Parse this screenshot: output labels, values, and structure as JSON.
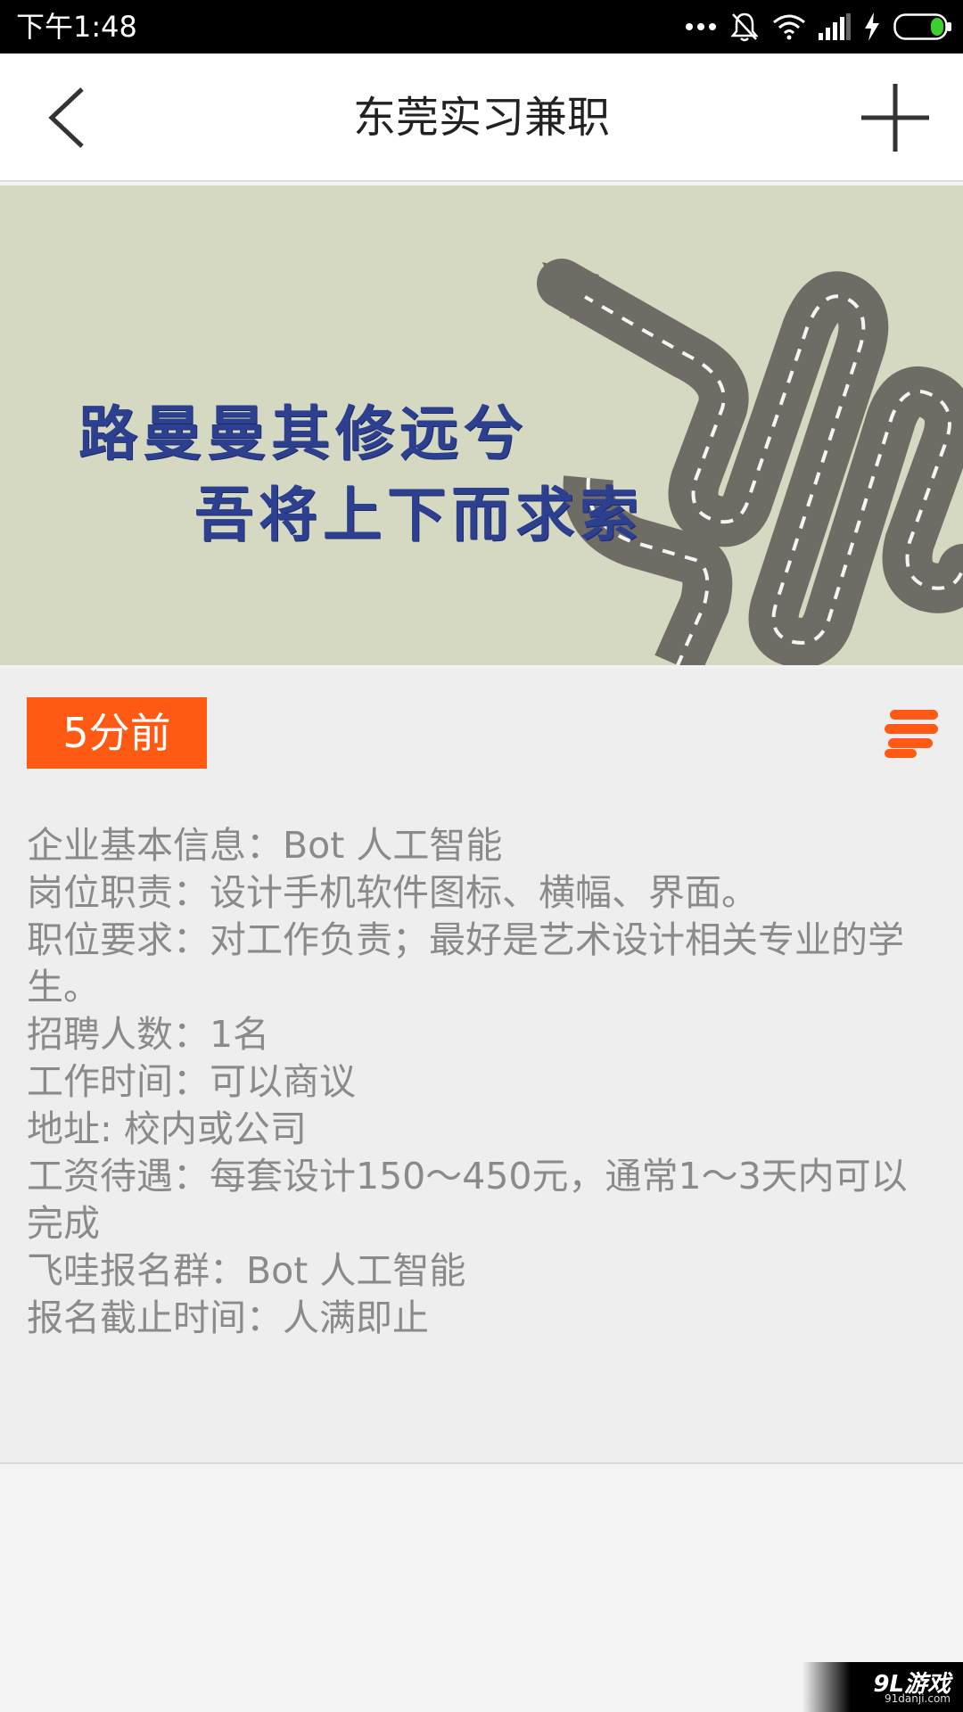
{
  "status_bar": {
    "time": "下午1:48",
    "icons": [
      "more-dots-icon",
      "bell-off-icon",
      "wifi-icon",
      "signal-icon",
      "charging-icon",
      "battery-icon"
    ],
    "battery_color": "#3ccf2e"
  },
  "header": {
    "title": "东莞实习兼职",
    "back_icon": "chevron-left-icon",
    "add_icon": "plus-icon"
  },
  "banner": {
    "line1": "路曼曼其修远兮",
    "line2": "吾将上下而求索",
    "image": "winding-road-arrow"
  },
  "post": {
    "time_badge": "5分前",
    "accent_color": "#ff5a14",
    "menu_icon": "menu-lines-icon",
    "lines": [
      "企业基本信息：Bot 人工智能",
      "岗位职责：设计手机软件图标、横幅、界面。",
      "职位要求：对工作负责；最好是艺术设计相关专业的学生。",
      "招聘人数：1名",
      "工作时间：可以商议",
      "地址: 校内或公司",
      "工资待遇：每套设计150～450元，通常1～3天内可以完成",
      "飞哇报名群：Bot 人工智能",
      "报名截止时间：人满即止"
    ]
  },
  "watermark": {
    "main": "9L游戏",
    "sub": "91danji.com"
  }
}
